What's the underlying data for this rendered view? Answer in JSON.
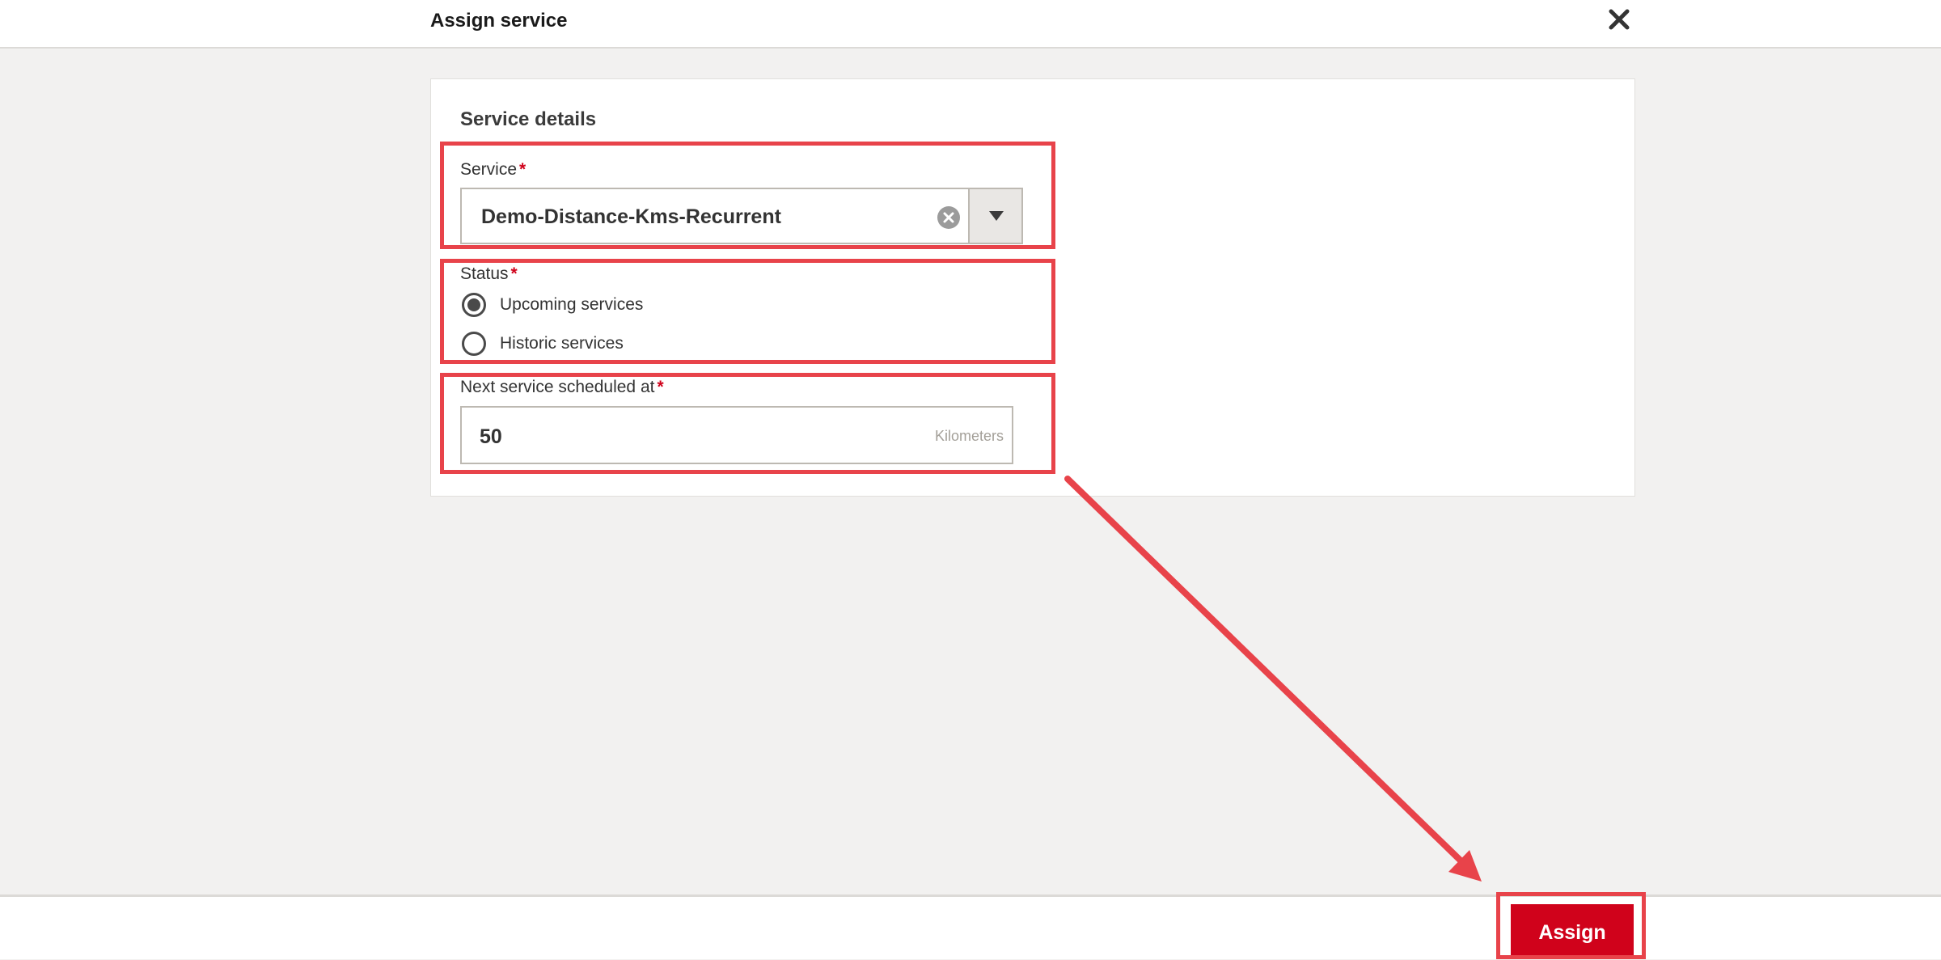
{
  "dialog": {
    "title": "Assign service"
  },
  "section": {
    "title": "Service details"
  },
  "service_field": {
    "label": "Service",
    "required_mark": "*",
    "value": "Demo-Distance-Kms-Recurrent"
  },
  "status_field": {
    "label": "Status",
    "required_mark": "*",
    "options": [
      {
        "label": "Upcoming services",
        "checked": true
      },
      {
        "label": "Historic services",
        "checked": false
      }
    ]
  },
  "next_service_field": {
    "label": "Next service scheduled at",
    "required_mark": "*",
    "value": "50",
    "unit": "Kilometers"
  },
  "footer": {
    "assign_label": "Assign"
  },
  "colors": {
    "accent": "#d0021b",
    "annotation": "#e8434a",
    "background": "#f2f1f0"
  },
  "icons": {
    "close": "close-icon",
    "clear": "clear-icon",
    "dropdown": "chevron-down-icon"
  }
}
